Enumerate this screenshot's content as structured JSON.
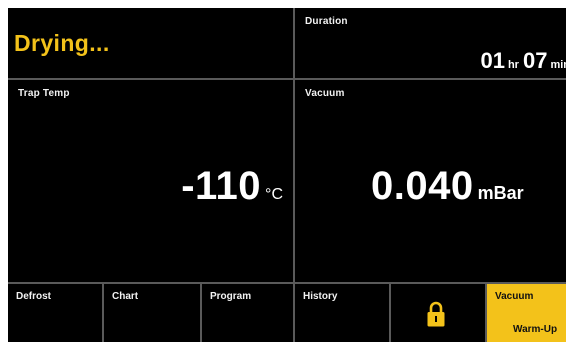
{
  "status": {
    "text": "Drying..."
  },
  "duration": {
    "label": "Duration",
    "hours": "01",
    "hours_unit": "hr",
    "minutes": "07",
    "minutes_unit": "min"
  },
  "trap_temp": {
    "label": "Trap Temp",
    "value": "-110",
    "unit": "°C"
  },
  "vacuum": {
    "label": "Vacuum",
    "value": "0.040",
    "unit": "mBar"
  },
  "nav": {
    "defrost": "Defrost",
    "chart": "Chart",
    "program": "Program",
    "history": "History",
    "lock_icon": "lock-icon",
    "vacuum": "Vacuum",
    "vacuum_sub": "Warm-Up"
  },
  "colors": {
    "accent": "#f3c21a",
    "background": "#000000",
    "divider": "#5a5a5a",
    "text": "#ffffff"
  }
}
